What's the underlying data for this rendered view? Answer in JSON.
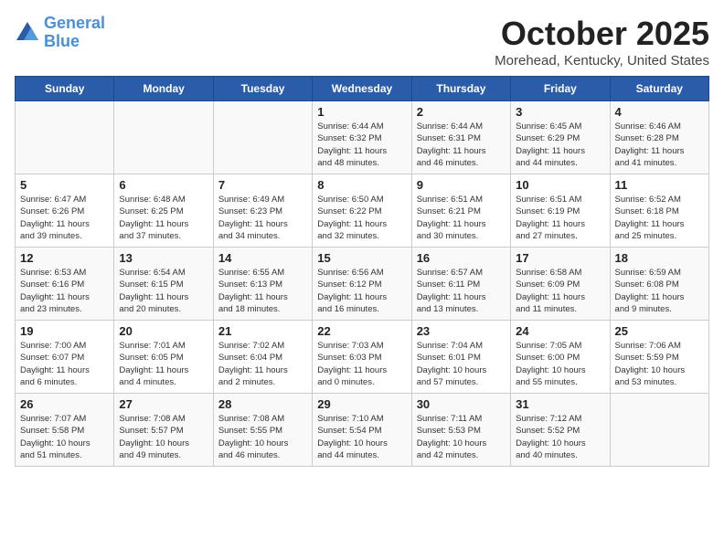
{
  "header": {
    "logo_line1": "General",
    "logo_line2": "Blue",
    "month": "October 2025",
    "location": "Morehead, Kentucky, United States"
  },
  "days_of_week": [
    "Sunday",
    "Monday",
    "Tuesday",
    "Wednesday",
    "Thursday",
    "Friday",
    "Saturday"
  ],
  "weeks": [
    [
      {
        "num": "",
        "info": ""
      },
      {
        "num": "",
        "info": ""
      },
      {
        "num": "",
        "info": ""
      },
      {
        "num": "1",
        "info": "Sunrise: 6:44 AM\nSunset: 6:32 PM\nDaylight: 11 hours\nand 48 minutes."
      },
      {
        "num": "2",
        "info": "Sunrise: 6:44 AM\nSunset: 6:31 PM\nDaylight: 11 hours\nand 46 minutes."
      },
      {
        "num": "3",
        "info": "Sunrise: 6:45 AM\nSunset: 6:29 PM\nDaylight: 11 hours\nand 44 minutes."
      },
      {
        "num": "4",
        "info": "Sunrise: 6:46 AM\nSunset: 6:28 PM\nDaylight: 11 hours\nand 41 minutes."
      }
    ],
    [
      {
        "num": "5",
        "info": "Sunrise: 6:47 AM\nSunset: 6:26 PM\nDaylight: 11 hours\nand 39 minutes."
      },
      {
        "num": "6",
        "info": "Sunrise: 6:48 AM\nSunset: 6:25 PM\nDaylight: 11 hours\nand 37 minutes."
      },
      {
        "num": "7",
        "info": "Sunrise: 6:49 AM\nSunset: 6:23 PM\nDaylight: 11 hours\nand 34 minutes."
      },
      {
        "num": "8",
        "info": "Sunrise: 6:50 AM\nSunset: 6:22 PM\nDaylight: 11 hours\nand 32 minutes."
      },
      {
        "num": "9",
        "info": "Sunrise: 6:51 AM\nSunset: 6:21 PM\nDaylight: 11 hours\nand 30 minutes."
      },
      {
        "num": "10",
        "info": "Sunrise: 6:51 AM\nSunset: 6:19 PM\nDaylight: 11 hours\nand 27 minutes."
      },
      {
        "num": "11",
        "info": "Sunrise: 6:52 AM\nSunset: 6:18 PM\nDaylight: 11 hours\nand 25 minutes."
      }
    ],
    [
      {
        "num": "12",
        "info": "Sunrise: 6:53 AM\nSunset: 6:16 PM\nDaylight: 11 hours\nand 23 minutes."
      },
      {
        "num": "13",
        "info": "Sunrise: 6:54 AM\nSunset: 6:15 PM\nDaylight: 11 hours\nand 20 minutes."
      },
      {
        "num": "14",
        "info": "Sunrise: 6:55 AM\nSunset: 6:13 PM\nDaylight: 11 hours\nand 18 minutes."
      },
      {
        "num": "15",
        "info": "Sunrise: 6:56 AM\nSunset: 6:12 PM\nDaylight: 11 hours\nand 16 minutes."
      },
      {
        "num": "16",
        "info": "Sunrise: 6:57 AM\nSunset: 6:11 PM\nDaylight: 11 hours\nand 13 minutes."
      },
      {
        "num": "17",
        "info": "Sunrise: 6:58 AM\nSunset: 6:09 PM\nDaylight: 11 hours\nand 11 minutes."
      },
      {
        "num": "18",
        "info": "Sunrise: 6:59 AM\nSunset: 6:08 PM\nDaylight: 11 hours\nand 9 minutes."
      }
    ],
    [
      {
        "num": "19",
        "info": "Sunrise: 7:00 AM\nSunset: 6:07 PM\nDaylight: 11 hours\nand 6 minutes."
      },
      {
        "num": "20",
        "info": "Sunrise: 7:01 AM\nSunset: 6:05 PM\nDaylight: 11 hours\nand 4 minutes."
      },
      {
        "num": "21",
        "info": "Sunrise: 7:02 AM\nSunset: 6:04 PM\nDaylight: 11 hours\nand 2 minutes."
      },
      {
        "num": "22",
        "info": "Sunrise: 7:03 AM\nSunset: 6:03 PM\nDaylight: 11 hours\nand 0 minutes."
      },
      {
        "num": "23",
        "info": "Sunrise: 7:04 AM\nSunset: 6:01 PM\nDaylight: 10 hours\nand 57 minutes."
      },
      {
        "num": "24",
        "info": "Sunrise: 7:05 AM\nSunset: 6:00 PM\nDaylight: 10 hours\nand 55 minutes."
      },
      {
        "num": "25",
        "info": "Sunrise: 7:06 AM\nSunset: 5:59 PM\nDaylight: 10 hours\nand 53 minutes."
      }
    ],
    [
      {
        "num": "26",
        "info": "Sunrise: 7:07 AM\nSunset: 5:58 PM\nDaylight: 10 hours\nand 51 minutes."
      },
      {
        "num": "27",
        "info": "Sunrise: 7:08 AM\nSunset: 5:57 PM\nDaylight: 10 hours\nand 49 minutes."
      },
      {
        "num": "28",
        "info": "Sunrise: 7:08 AM\nSunset: 5:55 PM\nDaylight: 10 hours\nand 46 minutes."
      },
      {
        "num": "29",
        "info": "Sunrise: 7:10 AM\nSunset: 5:54 PM\nDaylight: 10 hours\nand 44 minutes."
      },
      {
        "num": "30",
        "info": "Sunrise: 7:11 AM\nSunset: 5:53 PM\nDaylight: 10 hours\nand 42 minutes."
      },
      {
        "num": "31",
        "info": "Sunrise: 7:12 AM\nSunset: 5:52 PM\nDaylight: 10 hours\nand 40 minutes."
      },
      {
        "num": "",
        "info": ""
      }
    ]
  ]
}
